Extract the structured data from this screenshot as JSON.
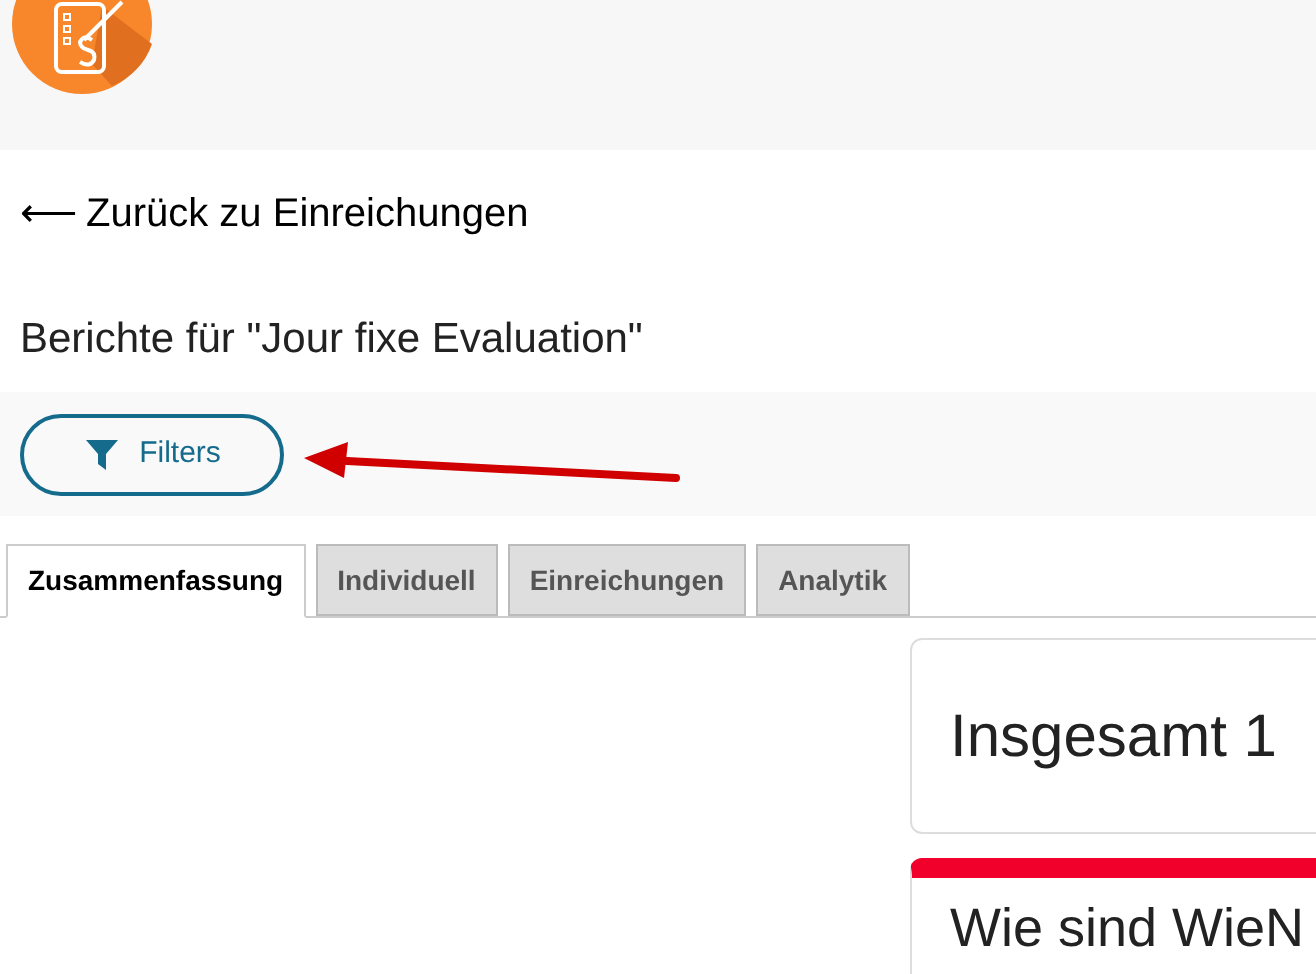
{
  "back_link": {
    "arrow": "⟵",
    "label": "Zurück zu Einreichungen"
  },
  "page_title": "Berichte für \"Jour fixe Evaluation\"",
  "filter_button": {
    "label": "Filters"
  },
  "tabs": [
    {
      "label": "Zusammenfassung",
      "selected": true
    },
    {
      "label": "Individuell",
      "selected": false
    },
    {
      "label": "Einreichungen",
      "selected": false
    },
    {
      "label": "Analytik",
      "selected": false
    }
  ],
  "cards": [
    {
      "kind": "total",
      "text": "Insgesamt 1"
    },
    {
      "kind": "question",
      "text": "Wie sind WieN",
      "color": "#f0002a"
    }
  ]
}
